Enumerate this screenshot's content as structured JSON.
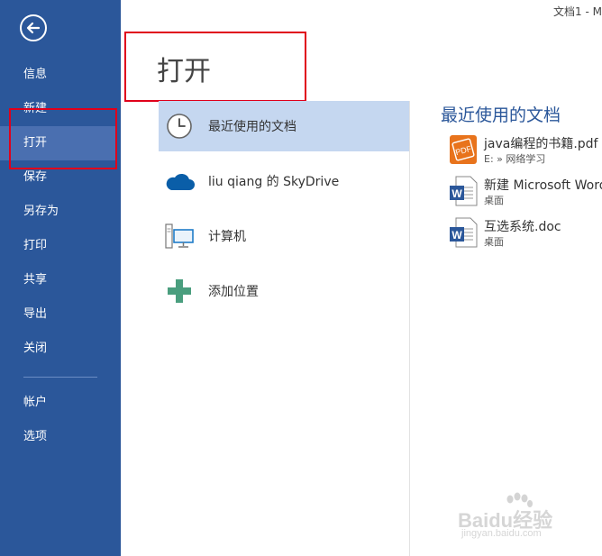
{
  "window": {
    "title": "文档1 - M"
  },
  "sidebar": {
    "items": [
      {
        "label": "信息"
      },
      {
        "label": "新建"
      },
      {
        "label": "打开"
      },
      {
        "label": "保存"
      },
      {
        "label": "另存为"
      },
      {
        "label": "打印"
      },
      {
        "label": "共享"
      },
      {
        "label": "导出"
      },
      {
        "label": "关闭"
      },
      {
        "label": "帐户"
      },
      {
        "label": "选项"
      }
    ],
    "active": "打开",
    "color": "#2b579a"
  },
  "main": {
    "title": "打开",
    "places": [
      {
        "label": "最近使用的文档",
        "icon": "clock-icon"
      },
      {
        "label": "liu qiang 的 SkyDrive",
        "icon": "cloud-icon"
      },
      {
        "label": "计算机",
        "icon": "computer-icon"
      },
      {
        "label": "添加位置",
        "icon": "plus-icon"
      }
    ],
    "recent": {
      "title": "最近使用的文档",
      "docs": [
        {
          "name": "java编程的书籍.pdf",
          "path": "E: » 网络学习",
          "icon": "pdf-icon"
        },
        {
          "name": "新建 Microsoft Word",
          "path": "桌面",
          "icon": "word-doc-icon"
        },
        {
          "name": "互选系统.doc",
          "path": "桌面",
          "icon": "word-doc-icon"
        }
      ]
    }
  },
  "watermark": {
    "brand": "Baidu经验",
    "url": "jingyan.baidu.com"
  }
}
